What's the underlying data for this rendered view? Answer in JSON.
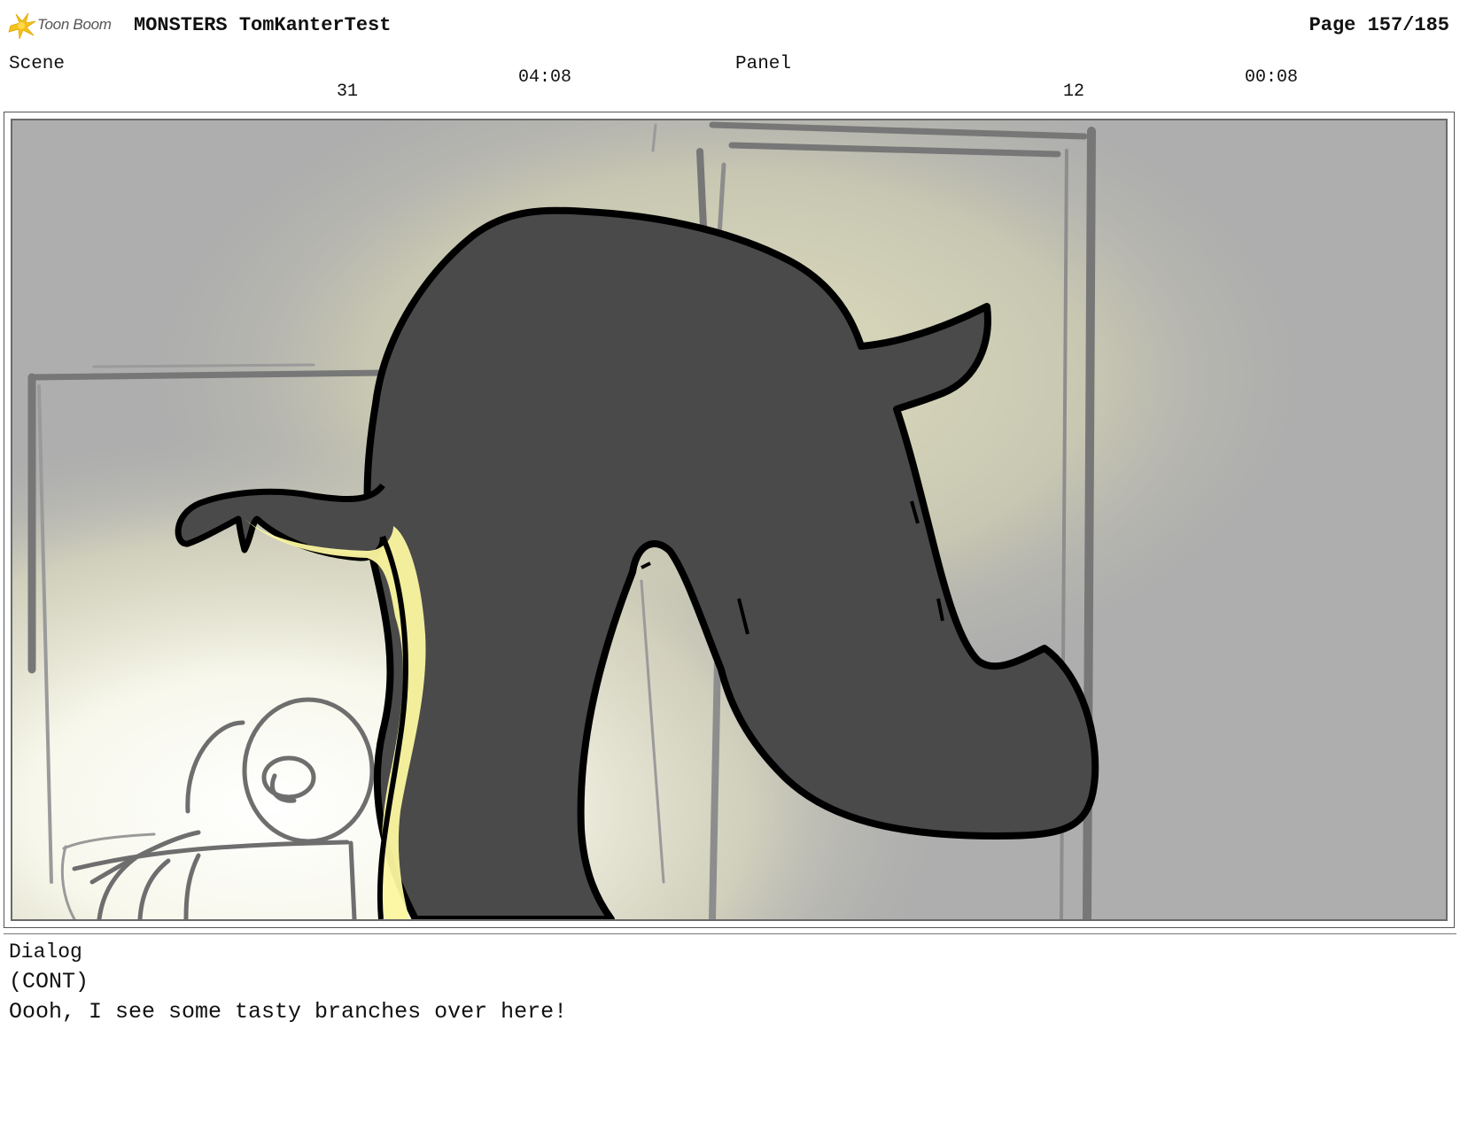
{
  "header": {
    "logo_text": "Toon Boom",
    "project_title": "MONSTERS TomKanterTest",
    "page_label": "Page 157/185"
  },
  "scene": {
    "label": "Scene",
    "number": "31",
    "duration": "04:08"
  },
  "panel": {
    "label": "Panel",
    "number": "12",
    "duration": "00:08"
  },
  "dialog": {
    "label": "Dialog",
    "lines": [
      "(CONT)",
      "Oooh, I see some tasty branches over here!"
    ]
  },
  "colors": {
    "panel_background": "#aeaeae",
    "spotlight": "#f6f5c8",
    "silhouette_fill": "#4a4a4a",
    "highlight": "#fbf7a0",
    "outline": "#000000"
  }
}
